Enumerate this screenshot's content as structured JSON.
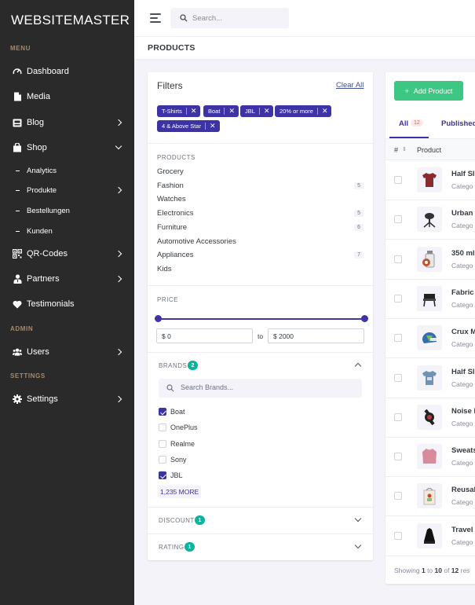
{
  "app": {
    "brand": "WEBSITEMASTER"
  },
  "sidebar": {
    "sections": {
      "menu": "MENU",
      "admin": "ADMIN",
      "settings": "SETTINGS"
    },
    "items": {
      "dashboard": "Dashboard",
      "media": "Media",
      "blog": "Blog",
      "shop": "Shop",
      "qr": "QR-Codes",
      "partners": "Partners",
      "testimonials": "Testimonials",
      "users": "Users",
      "settings": "Settings"
    },
    "shop_sub": {
      "analytics": "Analytics",
      "produkte": "Produkte",
      "bestellungen": "Bestellungen",
      "kunden": "Kunden"
    }
  },
  "topbar": {
    "search_placeholder": "Search..."
  },
  "page": {
    "title": "PRODUCTS"
  },
  "filters": {
    "title": "Filters",
    "clear_all": "Clear All",
    "chips": [
      "T-Shirts",
      "Boat",
      "JBL",
      "20% or more",
      "4 & Above Star"
    ],
    "products_label": "PRODUCTS",
    "categories": [
      {
        "name": "Grocery",
        "count": ""
      },
      {
        "name": "Fashion",
        "count": "5"
      },
      {
        "name": "Watches",
        "count": ""
      },
      {
        "name": "Electronics",
        "count": "5"
      },
      {
        "name": "Furniture",
        "count": "6"
      },
      {
        "name": "Automotive Accessories",
        "count": ""
      },
      {
        "name": "Appliances",
        "count": "7"
      },
      {
        "name": "Kids",
        "count": ""
      }
    ],
    "price_label": "PRICE",
    "price_min": "$ 0",
    "price_to": "to",
    "price_max": "$ 2000",
    "brands_label": "BRANDS",
    "brands_count": "2",
    "brands_search_placeholder": "Search Brands...",
    "brands": [
      {
        "name": "Boat",
        "checked": true
      },
      {
        "name": "OnePlus",
        "checked": false
      },
      {
        "name": "Realme",
        "checked": false
      },
      {
        "name": "Sony",
        "checked": false
      },
      {
        "name": "JBL",
        "checked": true
      }
    ],
    "more": "1,235 MORE",
    "discount_label": "DISCOUNT",
    "discount_count": "1",
    "rating_label": "RATING",
    "rating_count": "1"
  },
  "products": {
    "add_button": "Add Product",
    "add_icon": "+",
    "tabs": {
      "all": "All",
      "all_count": "12",
      "published": "Published"
    },
    "columns": {
      "hash": "#",
      "product": "Product"
    },
    "rows": [
      {
        "name": "Half Sl",
        "category": "Catego",
        "icon": "tshirt-maroon-icon"
      },
      {
        "name": "Urban",
        "category": "Catego",
        "icon": "chair-icon"
      },
      {
        "name": "350 ml",
        "category": "Catego",
        "icon": "bottle-icon"
      },
      {
        "name": "Fabric",
        "category": "Catego",
        "icon": "armchair-icon"
      },
      {
        "name": "Crux M",
        "category": "Catego",
        "icon": "helmet-icon"
      },
      {
        "name": "Half Sl",
        "category": "Catego",
        "icon": "tshirt-blue-icon"
      },
      {
        "name": "Noise E",
        "category": "Catego",
        "icon": "watch-icon"
      },
      {
        "name": "Sweats",
        "category": "Catego",
        "icon": "sweatshirt-icon"
      },
      {
        "name": "Reusal",
        "category": "Catego",
        "icon": "bag-icon"
      },
      {
        "name": "Travel",
        "category": "Catego",
        "icon": "backpack-icon"
      }
    ],
    "showing": {
      "prefix": "Showing ",
      "from": "1",
      "to_word": " to ",
      "to": "10",
      "of_word": " of ",
      "total": "12",
      "suffix": " res"
    }
  },
  "colors": {
    "sidebar_bg": "#2a2a2a",
    "accent": "#3d33a6",
    "success": "#3cc783",
    "badge_green": "#0ab39c"
  }
}
